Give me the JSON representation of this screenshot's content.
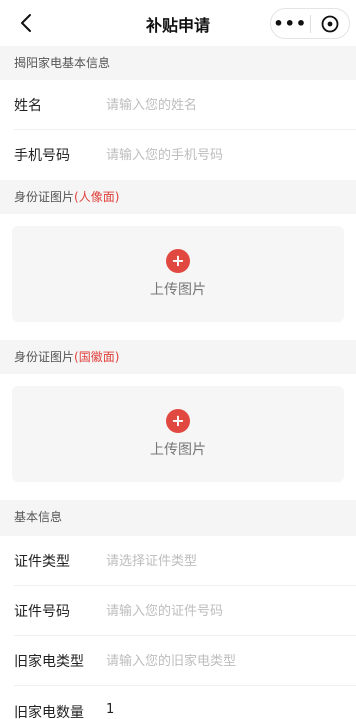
{
  "nav": {
    "title": "补贴申请",
    "back_icon": "chevron-left-icon",
    "more_icon": "more-dots-icon",
    "more_glyph": "•••",
    "close_icon": "close-circle-icon"
  },
  "sections": {
    "store_info": "揭阳家电基本信息",
    "id_front_prefix": "身份证图片",
    "id_front_suffix": "(人像面)",
    "id_back_prefix": "身份证图片",
    "id_back_suffix": "(国徽面)",
    "basic_info": "基本信息"
  },
  "fields": {
    "name": {
      "label": "姓名",
      "placeholder": "请输入您的姓名"
    },
    "phone": {
      "label": "手机号码",
      "placeholder": "请输入您的手机号码"
    },
    "id_type": {
      "label": "证件类型",
      "placeholder": "请选择证件类型"
    },
    "id_number": {
      "label": "证件号码",
      "placeholder": "请输入您的证件号码"
    },
    "old_type": {
      "label": "旧家电类型",
      "placeholder": "请输入您的旧家电类型"
    },
    "old_count": {
      "label": "旧家电数量",
      "value": "1"
    }
  },
  "upload": {
    "front": {
      "plus": "+",
      "label": "上传图片"
    },
    "back": {
      "plus": "+",
      "label": "上传图片"
    }
  },
  "colors": {
    "accent_red": "#e04840",
    "page_bg": "#f5f5f5"
  }
}
